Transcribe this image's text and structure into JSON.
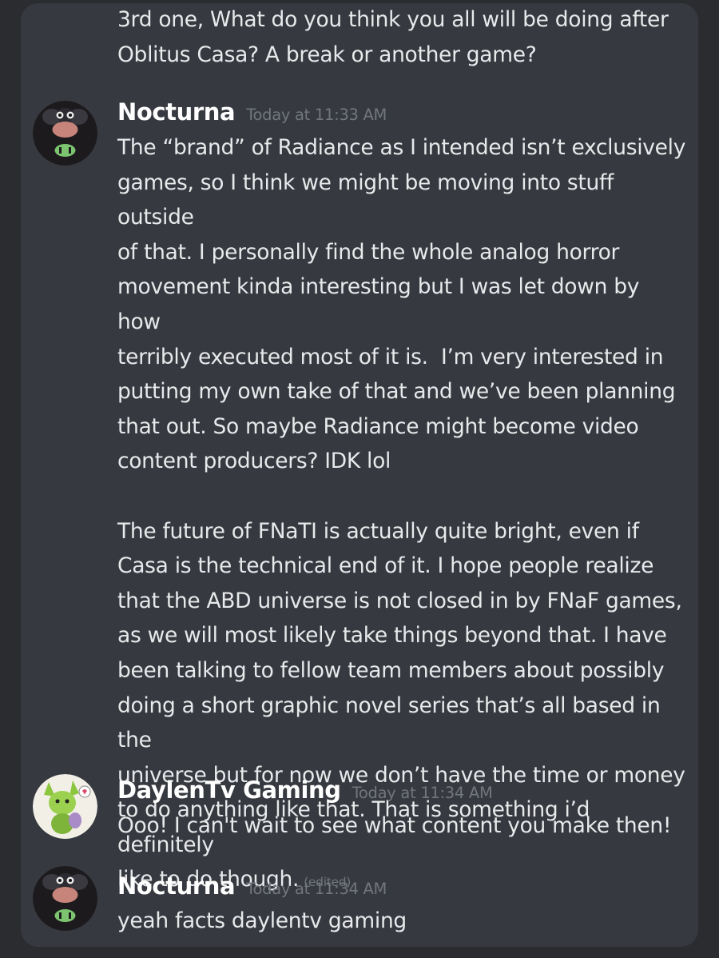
{
  "continuation": {
    "text": "3rd one, What do you think you all will be doing after\nOblitus Casa? A break or another game?"
  },
  "messages": [
    {
      "username": "Nocturna",
      "timestamp": "Today at 11:33 AM",
      "avatar": "dark-creature-avatar",
      "paragraphs": [
        "The “brand” of Radiance as I intended isn’t exclusively\ngames, so I think we might be moving into stuff outside\nof that. I personally find the whole analog horror\nmovement kinda interesting but I was let down by how\nterribly executed most of it is.  I’m very interested in\nputting my own take of that and we’ve been planning\nthat out. So maybe Radiance might become video\ncontent producers? IDK lol",
        "The future of FNaTI is actually quite bright, even if\nCasa is the technical end of it. I hope people realize\nthat the ABD universe is not closed in by FNaF games,\nas we will most likely take things beyond that. I have\nbeen talking to fellow team members about possibly\ndoing a short graphic novel series that’s all based in the\nuniverse but for now we don’t have the time or money\nto do anything like that. That is something i’d definitely\nlike to do though."
      ],
      "edited": "(edited)"
    },
    {
      "username": "DaylenTv Gaming",
      "timestamp": "Today at 11:34 AM",
      "avatar": "green-character-avatar",
      "text": "Ooo! I can't wait to see what content you make then!"
    },
    {
      "username": "Nocturna",
      "timestamp": "Today at 11:34 AM",
      "avatar": "dark-creature-avatar",
      "text": "yeah facts daylentv gaming"
    }
  ],
  "colors": {
    "background": "#2b2c2f",
    "panel": "#36393f",
    "username": "#ffffff",
    "timestamp": "#72767d",
    "text": "#e8e9eb"
  }
}
